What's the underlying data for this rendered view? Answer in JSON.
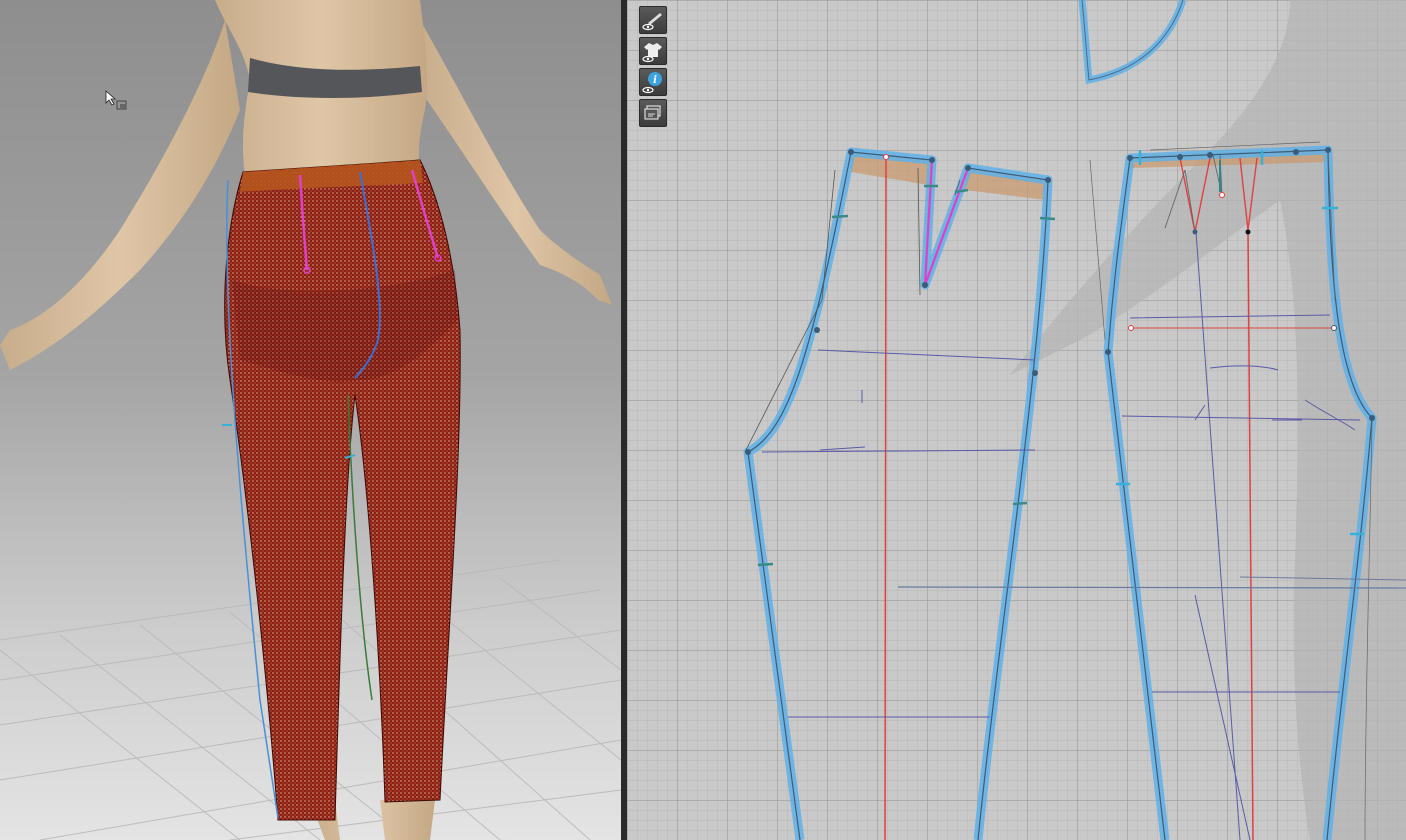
{
  "app": {
    "panes": [
      "3d-garment-view",
      "2d-pattern-view"
    ]
  },
  "toolbar2d": {
    "buttons": [
      {
        "name": "show-pattern-tool-button",
        "icon": "pen-eye-icon"
      },
      {
        "name": "show-garment-button",
        "icon": "shirt-eye-icon"
      },
      {
        "name": "show-info-button",
        "icon": "info-eye-icon"
      },
      {
        "name": "show-layer-button",
        "icon": "layers-icon"
      }
    ]
  },
  "colors": {
    "fabric": "#8c1e14",
    "waistband": "#b5541e",
    "outline": "#5fb0e6",
    "grainline": "#e24040",
    "dart": "#e040c8",
    "seam": "#3a6fd8",
    "baseline": "#5a5aa8"
  }
}
